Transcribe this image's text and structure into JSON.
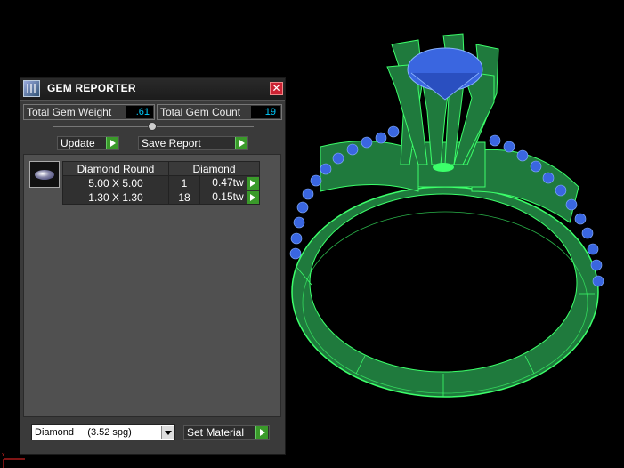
{
  "window": {
    "title": "GEM REPORTER",
    "close_symbol": "✕"
  },
  "stats": {
    "weight_label": "Total Gem Weight",
    "weight_value": ".61",
    "count_label": "Total Gem Count",
    "count_value": "19"
  },
  "actions": {
    "update_label": "Update",
    "save_report_label": "Save Report",
    "set_material_label": "Set Material"
  },
  "gem_table": {
    "headers": [
      "Diamond Round",
      "Diamond"
    ],
    "rows": [
      {
        "size": "5.00 X 5.00",
        "count": "1",
        "weight": "0.47tw"
      },
      {
        "size": "1.30 X 1.30",
        "count": "18",
        "weight": "0.15tw"
      }
    ]
  },
  "material": {
    "selected": "Diamond     (3.52 spg)"
  },
  "icons": [
    "gem-reporter-icon",
    "close-icon",
    "slider-knob",
    "arrow-right-icon",
    "dropdown-arrow-icon",
    "gem-thumbnail",
    "axis-icon"
  ],
  "colors": {
    "ring_metal": "#1e7a3c",
    "ring_wire": "#3cff6a",
    "gem": "#3a66e0",
    "value_text": "#00ccff",
    "arrow_button": "#3a9a2a"
  }
}
